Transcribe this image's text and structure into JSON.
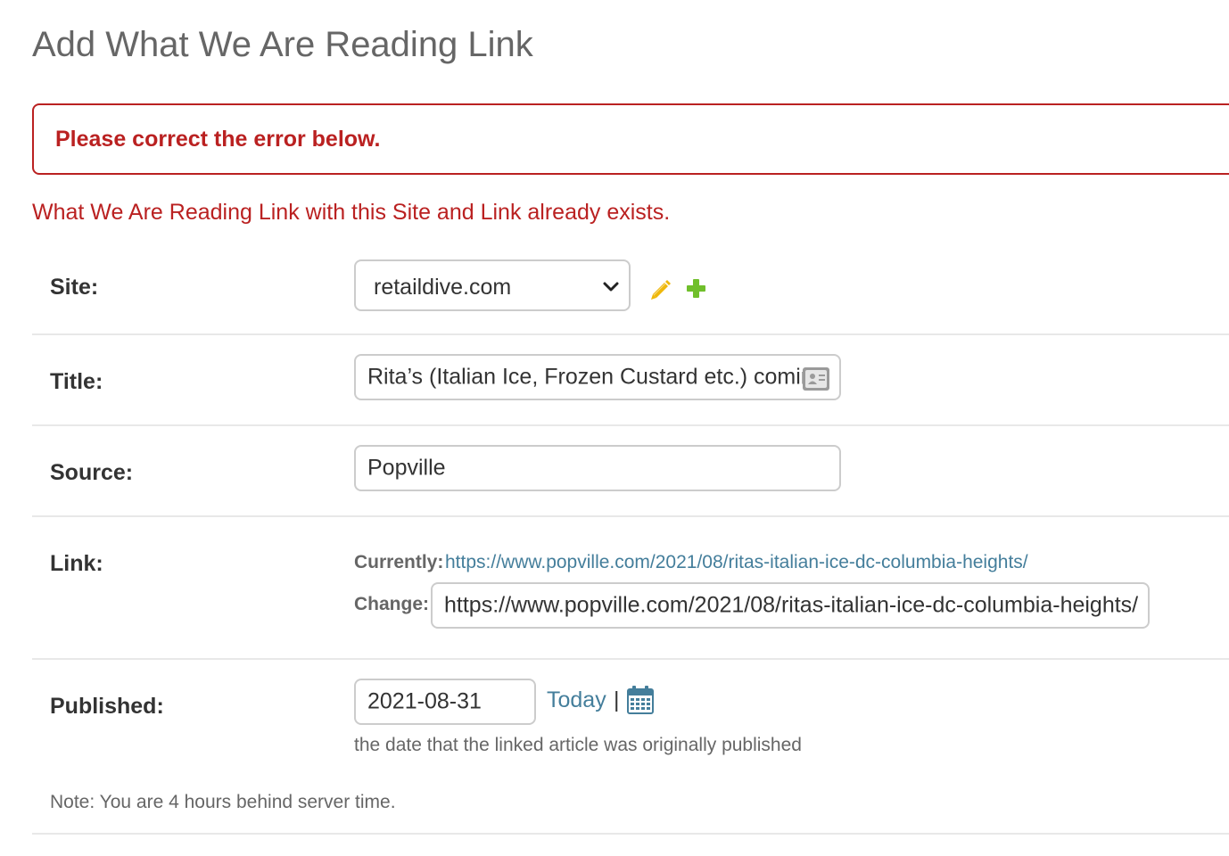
{
  "page": {
    "title": "Add What We Are Reading Link"
  },
  "errors": {
    "summary": "Please correct the error below.",
    "nonfield": "What We Are Reading Link with this Site and Link already exists."
  },
  "fields": {
    "site": {
      "label": "Site:",
      "selected": "retaildive.com"
    },
    "title": {
      "label": "Title:",
      "value": "Rita’s (Italian Ice, Frozen Custard etc.) coming"
    },
    "source": {
      "label": "Source:",
      "value": "Popville"
    },
    "link": {
      "label": "Link:",
      "currently_label": "Currently:",
      "currently_url": "https://www.popville.com/2021/08/ritas-italian-ice-dc-columbia-heights/",
      "change_label": "Change:",
      "change_value": "https://www.popville.com/2021/08/ritas-italian-ice-dc-columbia-heights/"
    },
    "published": {
      "label": "Published:",
      "value": "2021-08-31",
      "today_label": "Today",
      "separator": "|",
      "help": "the date that the linked article was originally published",
      "timezone_note": "Note: You are 4 hours behind server time."
    }
  },
  "icons": {
    "change": "pencil-icon",
    "add": "plus-icon",
    "calendar": "calendar-icon",
    "select_arrow": "chevron-down-icon",
    "autofill": "contact-card-icon"
  },
  "colors": {
    "error": "#ba2121",
    "link": "#447e9b",
    "pencil": "#efb80b",
    "plus": "#70bf2b"
  }
}
